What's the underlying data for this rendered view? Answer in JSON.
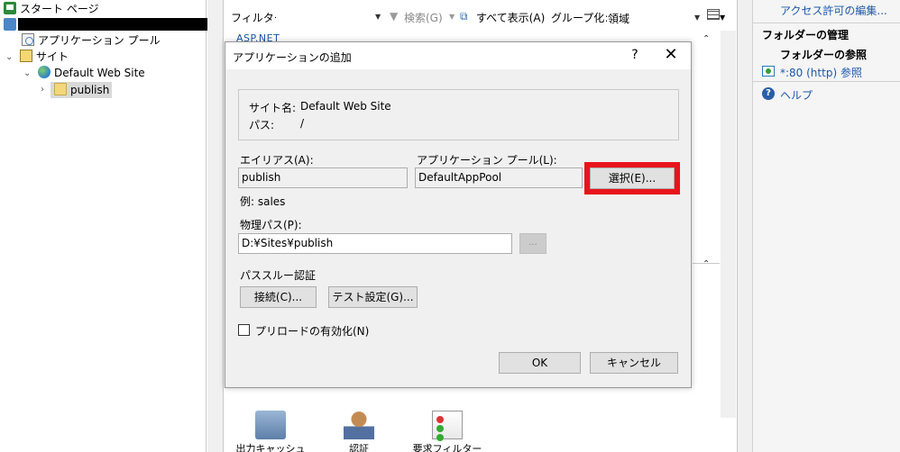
{
  "tree": {
    "start_page": "スタート ページ",
    "app_pools": "アプリケーション プール",
    "sites": "サイト",
    "default_site": "Default Web Site",
    "publish": "publish"
  },
  "filterbar": {
    "filter_label": "フィルター:",
    "search": "検索(G)",
    "show_all": "すべて表示(A)",
    "group_label": "グループ化:",
    "group_value": "領域"
  },
  "center": {
    "section_label": "ASP.NET",
    "features": [
      "出力キャッシュ",
      "認証",
      "要求フィルター"
    ]
  },
  "dialog": {
    "title": "アプリケーションの追加",
    "help": "?",
    "close": "✕",
    "site_name_label": "サイト名:",
    "site_name_value": "Default Web Site",
    "path_label": "パス:",
    "path_value": "/",
    "alias_label": "エイリアス(A):",
    "alias_value": "publish",
    "alias_example": "例: sales",
    "pool_label": "アプリケーション プール(L):",
    "pool_value": "DefaultAppPool",
    "select_button": "選択(E)...",
    "physical_path_label": "物理パス(P):",
    "physical_path_value": "D:¥Sites¥publish",
    "browse_button": "...",
    "passthrough_label": "パススルー認証",
    "connect_button": "接続(C)...",
    "test_settings_button": "テスト設定(G)...",
    "preload_label": "プリロードの有効化(N)",
    "ok_button": "OK",
    "cancel_button": "キャンセル"
  },
  "actions": {
    "edit_permissions": "アクセス許可の編集...",
    "manage_folder": "フォルダーの管理",
    "browse_folder": "フォルダーの参照",
    "browse_link": "*:80 (http) 参照",
    "help": "ヘルプ"
  },
  "colors": {
    "highlight_red": "#e8141c",
    "link_blue": "#1c58a8"
  }
}
